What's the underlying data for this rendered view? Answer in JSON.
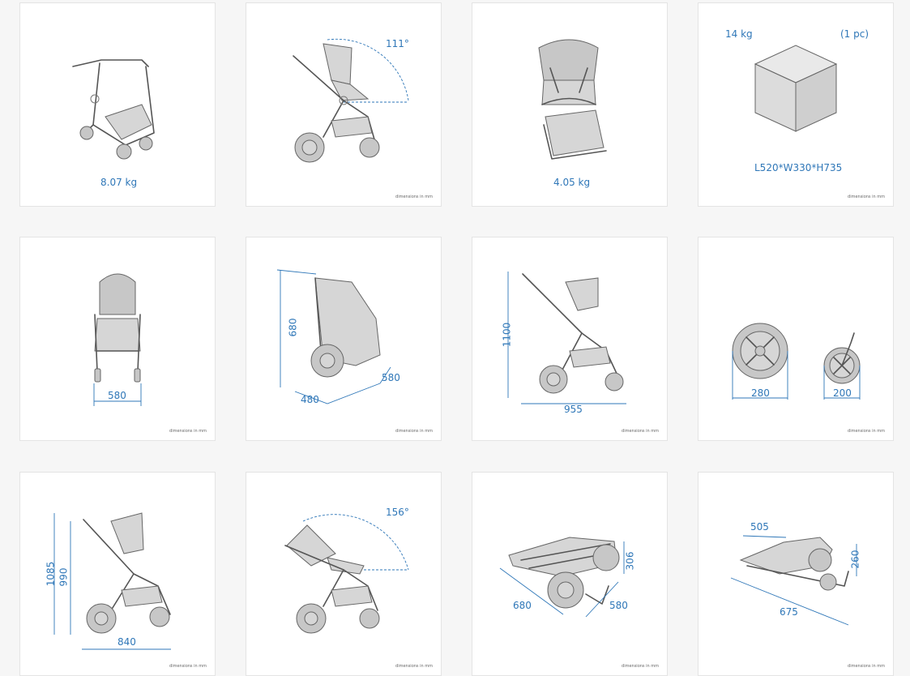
{
  "dimension_note": "dimensions in mm",
  "cards": [
    {
      "id": "frame-weight",
      "label": "8.07 kg"
    },
    {
      "id": "backrest-angle",
      "label": "111°"
    },
    {
      "id": "seat-weight",
      "label": "4.05 kg"
    },
    {
      "id": "package",
      "weight": "14 kg",
      "pieces": "(1 pc)",
      "dimensions": "L520*W330*H735"
    },
    {
      "id": "front-width",
      "width": "580"
    },
    {
      "id": "folded-size",
      "height": "680",
      "width": "480",
      "depth": "580"
    },
    {
      "id": "side-size",
      "height": "1100",
      "length": "955"
    },
    {
      "id": "wheel-sizes",
      "rear": "280",
      "front": "200"
    },
    {
      "id": "heights",
      "outer": "1085",
      "inner": "990",
      "length": "840"
    },
    {
      "id": "recline-angle",
      "label": "156°"
    },
    {
      "id": "fold-compact",
      "height": "306",
      "length": "680",
      "width": "580"
    },
    {
      "id": "fold-flat",
      "width": "505",
      "height": "260",
      "length": "675"
    }
  ]
}
